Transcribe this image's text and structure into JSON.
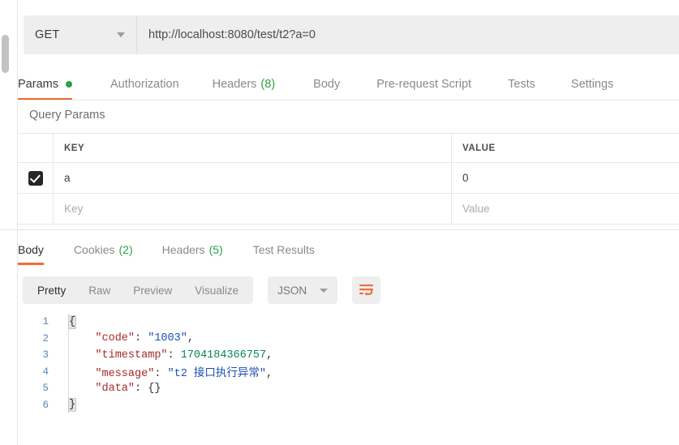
{
  "request": {
    "method": "GET",
    "method_caret_icon": "chevron-down-icon",
    "url": "http://localhost:8080/test/t2?a=0",
    "tabs": [
      {
        "label": "Params",
        "active": true,
        "dot": true,
        "count": ""
      },
      {
        "label": "Authorization",
        "active": false,
        "dot": false,
        "count": ""
      },
      {
        "label": "Headers",
        "active": false,
        "dot": false,
        "count": "(8)"
      },
      {
        "label": "Body",
        "active": false,
        "dot": false,
        "count": ""
      },
      {
        "label": "Pre-request Script",
        "active": false,
        "dot": false,
        "count": ""
      },
      {
        "label": "Tests",
        "active": false,
        "dot": false,
        "count": ""
      },
      {
        "label": "Settings",
        "active": false,
        "dot": false,
        "count": ""
      }
    ]
  },
  "query_params": {
    "section_title": "Query Params",
    "columns": {
      "key": "KEY",
      "value": "VALUE"
    },
    "rows": [
      {
        "checked": true,
        "key": "a",
        "value": "0",
        "placeholder": false
      },
      {
        "checked": false,
        "key": "Key",
        "value": "Value",
        "placeholder": true
      }
    ]
  },
  "response": {
    "tabs": [
      {
        "label": "Body",
        "active": true,
        "count": ""
      },
      {
        "label": "Cookies",
        "active": false,
        "count": "(2)"
      },
      {
        "label": "Headers",
        "active": false,
        "count": "(5)"
      },
      {
        "label": "Test Results",
        "active": false,
        "count": ""
      }
    ],
    "format_modes": [
      {
        "label": "Pretty",
        "active": true
      },
      {
        "label": "Raw",
        "active": false
      },
      {
        "label": "Preview",
        "active": false
      },
      {
        "label": "Visualize",
        "active": false
      }
    ],
    "language": "JSON",
    "language_caret_icon": "chevron-down-icon",
    "wrap_button_icon": "word-wrap-icon",
    "body_lines": [
      {
        "no": "1",
        "tokens": [
          {
            "t": "{",
            "c": "brace-hl"
          }
        ]
      },
      {
        "no": "2",
        "tokens": [
          {
            "t": "    ",
            "c": "punct"
          },
          {
            "t": "\"code\"",
            "c": "key"
          },
          {
            "t": ": ",
            "c": "punct"
          },
          {
            "t": "\"1003\"",
            "c": "str"
          },
          {
            "t": ",",
            "c": "punct"
          }
        ]
      },
      {
        "no": "3",
        "tokens": [
          {
            "t": "    ",
            "c": "punct"
          },
          {
            "t": "\"timestamp\"",
            "c": "key"
          },
          {
            "t": ": ",
            "c": "punct"
          },
          {
            "t": "1704184366757",
            "c": "num"
          },
          {
            "t": ",",
            "c": "punct"
          }
        ]
      },
      {
        "no": "4",
        "tokens": [
          {
            "t": "    ",
            "c": "punct"
          },
          {
            "t": "\"message\"",
            "c": "key"
          },
          {
            "t": ": ",
            "c": "punct"
          },
          {
            "t": "\"t2 接口执行异常\"",
            "c": "str"
          },
          {
            "t": ",",
            "c": "punct"
          }
        ]
      },
      {
        "no": "5",
        "tokens": [
          {
            "t": "    ",
            "c": "punct"
          },
          {
            "t": "\"data\"",
            "c": "key"
          },
          {
            "t": ": ",
            "c": "punct"
          },
          {
            "t": "{}",
            "c": "punct"
          }
        ]
      },
      {
        "no": "6",
        "tokens": [
          {
            "t": "}",
            "c": "brace-hl"
          }
        ]
      }
    ]
  },
  "colors": {
    "accent_orange": "#ef6c33",
    "green": "#2aa247",
    "json_key": "#a52a2a",
    "json_string": "#1a4fb4",
    "json_number": "#0b8457",
    "lineno": "#5a86b3"
  }
}
